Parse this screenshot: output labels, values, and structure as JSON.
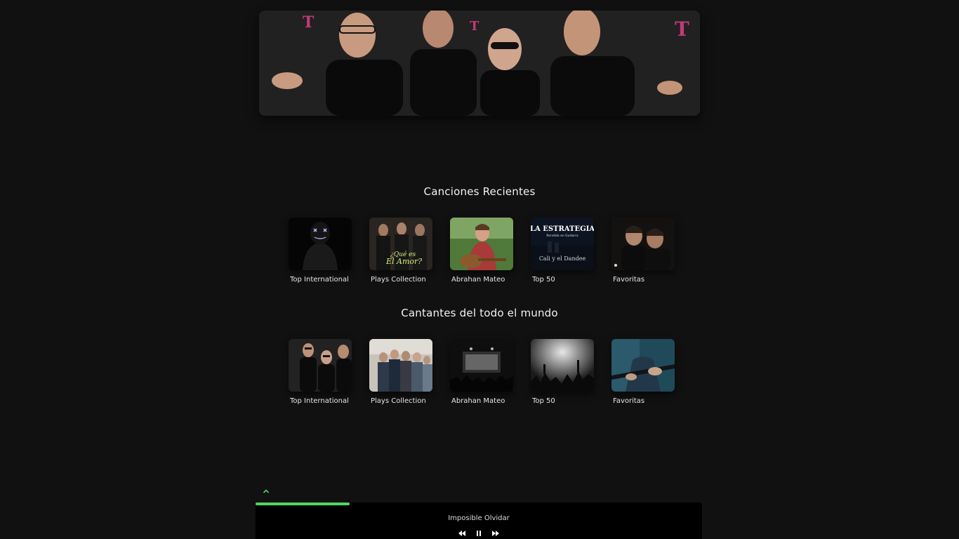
{
  "banner": {
    "alt": "band-photo",
    "logo_letter": "T"
  },
  "sections": [
    {
      "title": "Canciones Recientes",
      "cards": [
        {
          "label": "Top International",
          "icon": "masked-figure-image"
        },
        {
          "label": "Plays Collection",
          "icon": "album-cover-image",
          "cover_text_1": "¿Qué es",
          "cover_text_2": "El Amor?"
        },
        {
          "label": "Abrahan Mateo",
          "icon": "guitarist-image"
        },
        {
          "label": "Top 50",
          "icon": "album-cover-image",
          "cover_title": "LA ESTRATEGIA",
          "cover_subtitle": "Rendido en Guitarra",
          "cover_artist": "Cali y el Dandee"
        },
        {
          "label": "Favoritas",
          "icon": "duo-image"
        }
      ]
    },
    {
      "title": "Cantantes del todo el mundo",
      "cards": [
        {
          "label": "Top International",
          "icon": "band-image"
        },
        {
          "label": "Plays Collection",
          "icon": "group-image"
        },
        {
          "label": "Abrahan Mateo",
          "icon": "concert-stage-image"
        },
        {
          "label": "Top 50",
          "icon": "crowd-image"
        },
        {
          "label": "Favoritas",
          "icon": "guitar-image"
        }
      ]
    }
  ],
  "player": {
    "track": "Imposible Olvidar",
    "progress": 0.21,
    "accent": "#4cd964"
  }
}
